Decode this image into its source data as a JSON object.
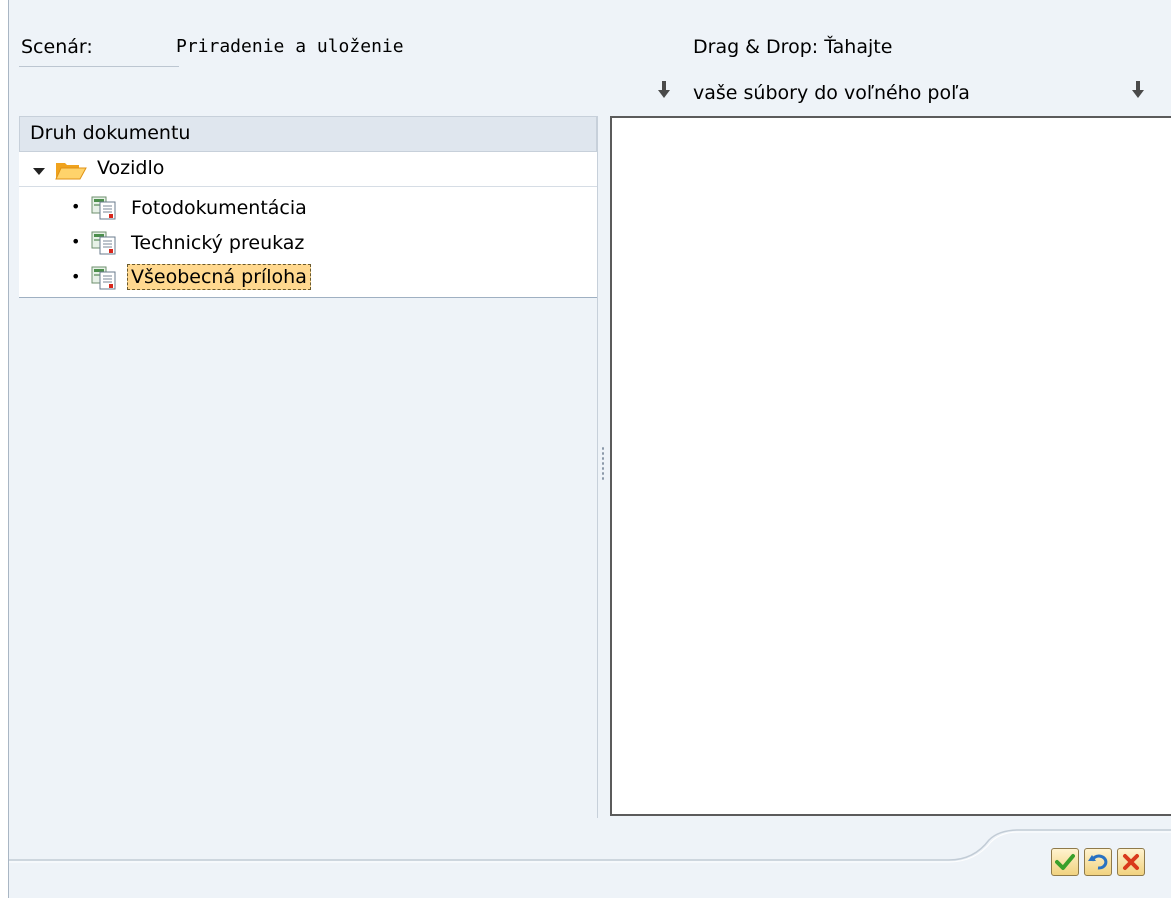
{
  "scenario": {
    "label": "Scenár:",
    "value": "Priradenie a uloženie"
  },
  "drag_drop": {
    "line1": "Drag & Drop: Ťahajte",
    "line2": "vaše súbory do voľného poľa"
  },
  "tree": {
    "header": "Druh dokumentu",
    "root": {
      "label": "Vozidlo",
      "icon": "folder-open-icon"
    },
    "children": [
      {
        "label": "Fotodokumentácia",
        "icon": "document-type-icon"
      },
      {
        "label": "Technický preukaz",
        "icon": "document-type-icon"
      },
      {
        "label": "Všeobecná príloha",
        "icon": "document-type-icon",
        "selected": true
      }
    ]
  },
  "footer": {
    "buttons": [
      {
        "name": "confirm",
        "icon": "check-icon",
        "color": "#3aa02b"
      },
      {
        "name": "undo",
        "icon": "undo-icon",
        "color": "#2a72c2"
      },
      {
        "name": "cancel",
        "icon": "close-icon",
        "color": "#d93a1c"
      }
    ]
  },
  "colors": {
    "background": "#eef3f8",
    "header": "#dfe6ee",
    "selection": "#ffd88f",
    "folder": "#f5a623"
  }
}
